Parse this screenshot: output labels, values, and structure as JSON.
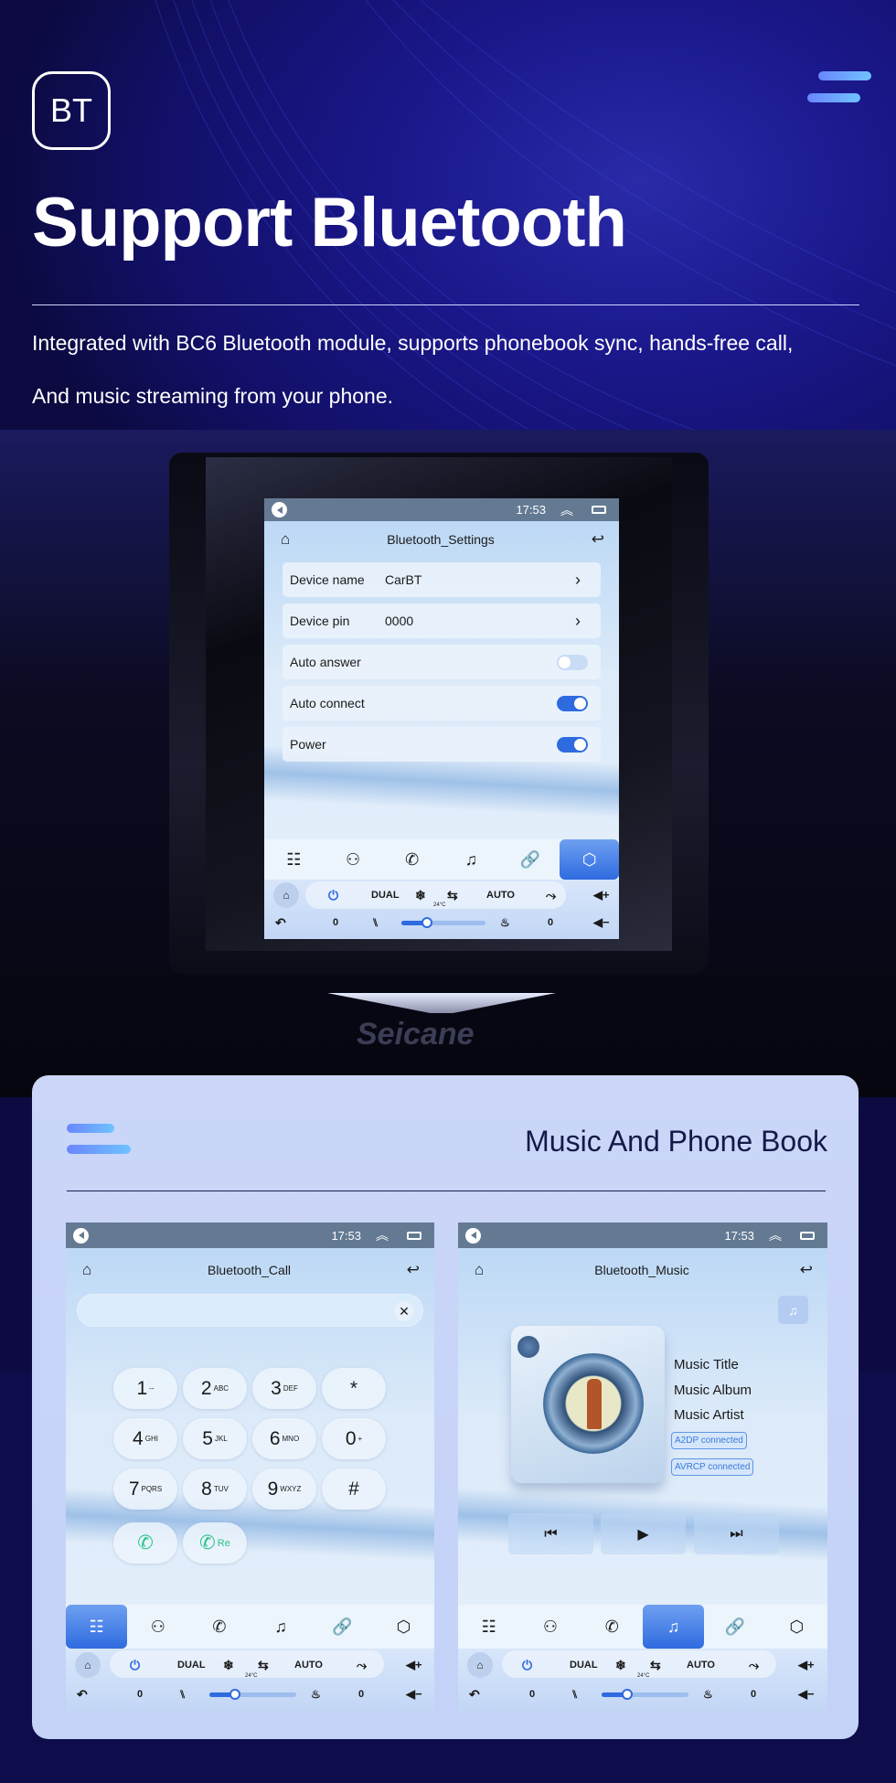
{
  "hero": {
    "badge": "BT",
    "title": "Support Bluetooth",
    "desc_line1": "Integrated with BC6 Bluetooth module, supports phonebook sync, hands-free call,",
    "desc_line2": "And music streaming from your phone.",
    "brand_watermark": "Seicane"
  },
  "status_bar": {
    "time": "17:53"
  },
  "settings_screen": {
    "title": "Bluetooth_Settings",
    "rows": [
      {
        "label": "Device name",
        "value": "CarBT",
        "type": "link"
      },
      {
        "label": "Device pin",
        "value": "0000",
        "type": "link"
      },
      {
        "label": "Auto answer",
        "type": "toggle",
        "on": false
      },
      {
        "label": "Auto connect",
        "type": "toggle",
        "on": true
      },
      {
        "label": "Power",
        "type": "toggle",
        "on": true
      }
    ],
    "active_tab": "settings"
  },
  "nav_tabs": [
    "dialpad",
    "contacts",
    "call-log",
    "music",
    "link",
    "settings"
  ],
  "climate": {
    "dual": "DUAL",
    "auto": "AUTO",
    "temp": "24°C",
    "left_value": "0",
    "right_value": "0",
    "fan_level": 0.3
  },
  "card": {
    "title": "Music And Phone Book"
  },
  "call_screen": {
    "title": "Bluetooth_Call",
    "search_value": "",
    "keys": [
      {
        "d": "1",
        "s": "--"
      },
      {
        "d": "2",
        "s": "ABC"
      },
      {
        "d": "3",
        "s": "DEF"
      },
      {
        "d": "*",
        "s": ""
      },
      {
        "d": "4",
        "s": "GHI"
      },
      {
        "d": "5",
        "s": "JKL"
      },
      {
        "d": "6",
        "s": "MNO"
      },
      {
        "d": "0",
        "s": "+"
      },
      {
        "d": "7",
        "s": "PQRS"
      },
      {
        "d": "8",
        "s": "TUV"
      },
      {
        "d": "9",
        "s": "WXYZ"
      },
      {
        "d": "#",
        "s": ""
      }
    ],
    "redial_label": "Re",
    "active_tab": "dialpad"
  },
  "music_screen": {
    "title": "Bluetooth_Music",
    "track_title": "Music Title",
    "album": "Music Album",
    "artist": "Music Artist",
    "a2dp": "A2DP  connected",
    "avrcp": "AVRCP connected",
    "active_tab": "music"
  },
  "colors": {
    "accent": "#2f6be0",
    "status_bar": "#647a93",
    "card_bg": "#cbd6f8"
  }
}
